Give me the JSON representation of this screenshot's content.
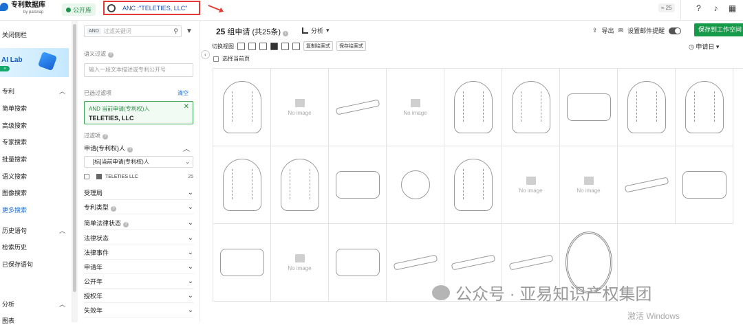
{
  "topbar": {
    "logo_title": "专利数据库",
    "logo_sub": "by patsnap",
    "public_label": "公开库",
    "query": "ANC :\"TELETIES, LLC\"",
    "count_badge": "≈ 25"
  },
  "sidebar": {
    "collapse": "关闭侧栏",
    "ai_lab": "AI Lab",
    "patent_section": "专利",
    "items": [
      "简单搜索",
      "高级搜索",
      "专家搜索",
      "批量搜索",
      "语义搜索",
      "图像搜索",
      "更多搜索"
    ],
    "history_section": "历史语句",
    "history_items": [
      "检索历史",
      "已保存语句"
    ],
    "analysis_section": "分析",
    "analysis_item": "图表"
  },
  "filter": {
    "search_and": "AND",
    "search_placeholder": "过滤关键词",
    "semantic_label": "语义过滤",
    "semantic_placeholder": "输入一段文本描述或专利公开号",
    "selected_label": "已选过滤项",
    "clear": "清空",
    "chip_line1": "AND  当前申请(专利权)人",
    "chip_line2": "TELETIES, LLC",
    "items_label": "过滤项",
    "applicant_header": "申请(专利权)人",
    "select_value": "[标]当前申请(专利权)人",
    "checkbox_name": "TELETIES LLC",
    "checkbox_count": "25",
    "facets": [
      "受理局",
      "专利类型",
      "简单法律状态",
      "法律状态",
      "法律事件",
      "申请年",
      "公开年",
      "授权年",
      "失效年"
    ]
  },
  "main": {
    "title_count": "25",
    "title_rest": "组申请 (共25条)",
    "analysis": "分析",
    "export": "导出",
    "email_alert": "设置邮件提醒",
    "save_btn": "保存到工作空间",
    "view_label": "切换视图",
    "copy_style": "复制绘案式",
    "save_style": "保存绘案式",
    "sort": "申请日",
    "select_page": "选择当前页",
    "no_image": "No image"
  },
  "watermark": "公众号 · 亚易知识产权集团",
  "windows": "激活 Windows"
}
